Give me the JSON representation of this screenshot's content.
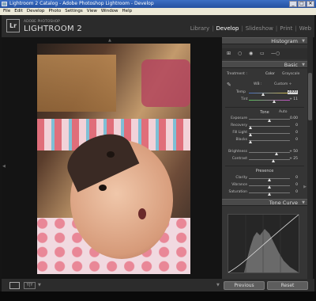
{
  "window": {
    "title": "Lightroom 2 Catalog - Adobe Photoshop Lightroom - Develop",
    "buttons": [
      "_",
      "□",
      "✕"
    ]
  },
  "menubar": [
    "File",
    "Edit",
    "Develop",
    "Photo",
    "Settings",
    "View",
    "Window",
    "Help"
  ],
  "header": {
    "logo": "Lr",
    "catalog_label": "ADOBE PHOTOSHOP",
    "product": "LIGHTROOM 2",
    "modules": [
      "Library",
      "Develop",
      "Slideshow",
      "Print",
      "Web"
    ],
    "active_module": "Develop"
  },
  "panel": {
    "histogram_title": "Histogram",
    "basic_title": "Basic",
    "treatment": {
      "label": "Treatment :",
      "color": "Color",
      "grayscale": "Grayscale"
    },
    "wb": {
      "label": "WB :",
      "value": "Custom ÷"
    },
    "temp": {
      "label": "Temp",
      "value": "2400",
      "pos": 0.35
    },
    "tint": {
      "label": "Tint",
      "value": "+ 11",
      "pos": 0.62
    },
    "tone": {
      "title": "Tone",
      "auto": "Auto"
    },
    "tone_sliders": [
      {
        "label": "Exposure",
        "value": "0.00",
        "pos": 0.5
      },
      {
        "label": "Recovery",
        "value": "0",
        "pos": 0.04
      },
      {
        "label": "Fill Light",
        "value": "0",
        "pos": 0.04
      },
      {
        "label": "Blacks",
        "value": "0",
        "pos": 0.04
      }
    ],
    "tone_sliders2": [
      {
        "label": "Brightness",
        "value": "+ 50",
        "pos": 0.68
      },
      {
        "label": "Contrast",
        "value": "+ 25",
        "pos": 0.6
      }
    ],
    "presence": {
      "title": "Presence"
    },
    "presence_sliders": [
      {
        "label": "Clarity",
        "value": "0",
        "pos": 0.5
      },
      {
        "label": "Vibrance",
        "value": "0",
        "pos": 0.5
      },
      {
        "label": "Saturation",
        "value": "0",
        "pos": 0.5
      }
    ],
    "tone_curve_title": "Tone Curve"
  },
  "toolbar": {
    "previous": "Previous",
    "reset": "Reset",
    "yy": "Y|Y"
  },
  "icons": [
    "crop-icon",
    "spot-removal-icon",
    "red-eye-icon",
    "graduated-filter-icon",
    "adjustment-brush-icon",
    "eyedropper-icon",
    "lr-logo-icon"
  ]
}
